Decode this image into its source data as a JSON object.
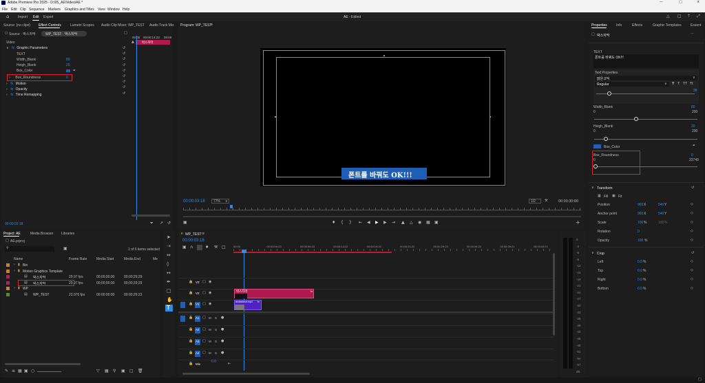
{
  "app": {
    "title": "Adobe Premiere Pro 2025 - D:\\05_AE\\Video\\AE *",
    "center_title": "AE",
    "edited": "- Edited"
  },
  "menu": [
    "File",
    "Edit",
    "Clip",
    "Sequence",
    "Markers",
    "Graphics and Titles",
    "View",
    "Window",
    "Help"
  ],
  "workspace": {
    "home": "Home",
    "import": "Import",
    "edit": "Edit",
    "export": "Export"
  },
  "source_tabs": [
    "Source: (no clips)",
    "Effect Controls",
    "Lumetri Scopes",
    "Audio Clip Mixer: WP_TEST",
    "Audio Track Mix"
  ],
  "effect_controls": {
    "source_label": "Source · 박스자막",
    "seq_label": "WP_TEST · 박스자막",
    "tc_start": "00:00",
    "tc_mid": "00:00:14:23",
    "tc_end": "00:00",
    "clip_label": "박스자막",
    "video": "Video",
    "graphic": "Graphic Parameters",
    "text": "TEXT",
    "width_blank": "Width_Blank",
    "width_val": "80",
    "heigh_blank": "Heigh_Blank",
    "heigh_val": "20",
    "box_color": "Box_Color",
    "box_round": "Box_Roundness",
    "box_round_val": "0",
    "motion": "Motion",
    "opacity": "Opacity",
    "time_remap": "Time Remapping",
    "timecode": "00:00:03:18"
  },
  "program": {
    "title": "Program: WP_TEST",
    "subtitle": "폰트를 바꿔도 OK!!!",
    "timecode": "00:00:03:18",
    "fit": "77%",
    "quality": "1/2",
    "duration": "00:00:30:00"
  },
  "project": {
    "tabs": [
      "Project: AE",
      "Media Browser",
      "Libraries"
    ],
    "file": "AE.prproj",
    "selected": "1 of 6 items selected",
    "cols": [
      "Name",
      "Frame Rate",
      "Media Start",
      "Media End",
      "Me"
    ],
    "rows": [
      {
        "name": "Bin",
        "rate": "",
        "start": "",
        "end": "",
        "color": "#d97b1f",
        "indent": 0
      },
      {
        "name": "Motion Graphics Template",
        "rate": "",
        "start": "",
        "end": "",
        "color": "#d97b1f",
        "indent": 0
      },
      {
        "name": "박스자막",
        "rate": "29.97 fps",
        "start": "00;00;00;00",
        "end": "00;00;29;29",
        "color": "#c2185b",
        "indent": 1
      },
      {
        "name": "박스자막",
        "rate": "29.97 fps",
        "start": "00;00;00;00",
        "end": "00;00;29;29",
        "color": "#c2185b",
        "indent": 1
      },
      {
        "name": "WP",
        "rate": "",
        "start": "",
        "end": "",
        "color": "#d97b1f",
        "indent": 0
      },
      {
        "name": "WP_TEST",
        "rate": "23.976 fps",
        "start": "00:00:00:00",
        "end": "00:00:29:23",
        "color": "#5a8a2a",
        "indent": 1
      }
    ]
  },
  "timeline": {
    "tab": "WP_TEST",
    "timecode": "00:00:03:18",
    "ruler": [
      "00:00",
      "00:00:04:23",
      "00:00:09:23",
      "00:00:14:22",
      "00:00:19:22",
      "00:00:24:22",
      "00:00:29:23",
      "00:00:34:22",
      "00:00:39:21",
      "00:00:44:21"
    ],
    "tracks": [
      "V3",
      "V2",
      "V1",
      "A1",
      "A2",
      "A3",
      "A4",
      "Mix"
    ],
    "clip_title": "박스자막",
    "clip_video": "asdasddsd.mp4",
    "fx": "fx",
    "mix_val": "0.0"
  },
  "meter": [
    "0",
    "-3",
    "-6",
    "-9",
    "-12",
    "-15",
    "-18",
    "-21",
    "-24",
    "-27",
    "-30",
    "-33",
    "-36",
    "-39",
    "-42",
    "-45",
    "-48",
    "-51",
    "-54",
    "-57",
    "dB"
  ],
  "properties": {
    "tabs": [
      "Properties",
      "Info",
      "Effects",
      "Graphic Templates",
      "Essent"
    ],
    "title": "박스자막",
    "text_label": "TEXT",
    "text_val": "폰트를 바꿔도 OK!!!",
    "text_props": "Text Properties",
    "font": "맑은고딕",
    "style": "Regular",
    "size": "38",
    "width_blank": "Width_Blank",
    "w_min": "0",
    "w_max": "200",
    "w_val": "80",
    "heigh_blank": "Heigh_Blank",
    "h_min": "0",
    "h_max": "200",
    "h_val": "20",
    "box_color": "Box_Color",
    "box_round": "Box_Roundness",
    "r_val": "0",
    "r_min": "0",
    "r_max": "22749",
    "transform": "Transform",
    "fill": "Fill",
    "fit": "Fit",
    "position": "Position",
    "pos_x": "960",
    "pos_y": "540",
    "anchor": "Anchor point",
    "anc_x": "960",
    "anc_y": "540",
    "scale": "Scale",
    "scale_val": "100",
    "pct": "%",
    "rotation": "Rotation",
    "rot_val": "0",
    "opacity": "Opacity",
    "op_val": "100",
    "crop": "Crop",
    "left": "Left",
    "top": "Top",
    "right": "Right",
    "bottom": "Bottom",
    "crop_val": "0.0",
    "x": "X",
    "y": "Y"
  }
}
